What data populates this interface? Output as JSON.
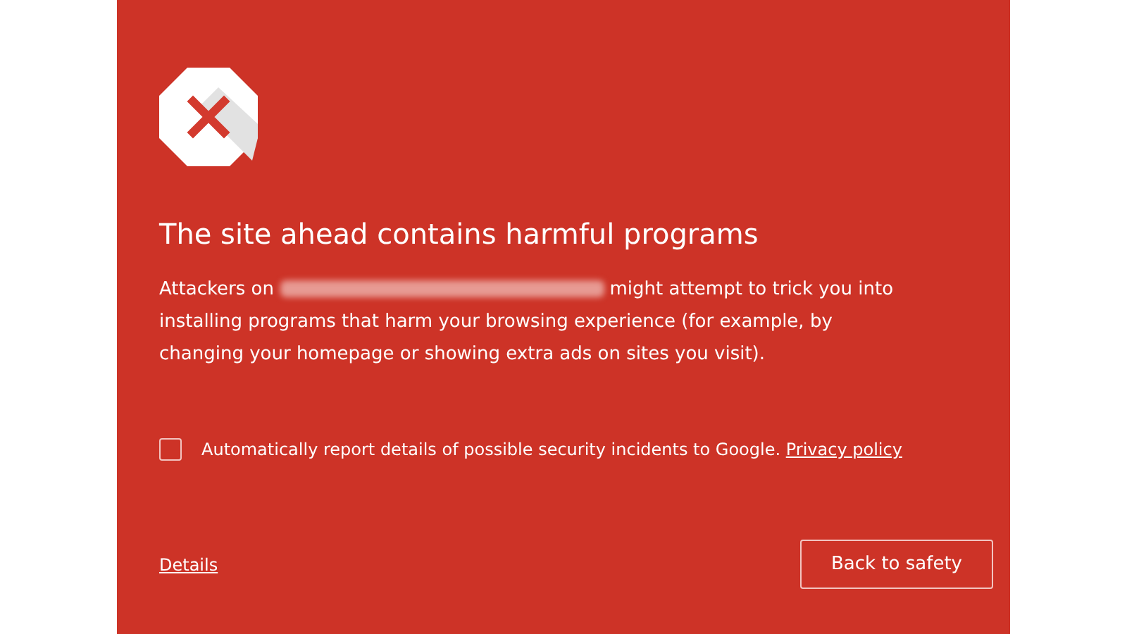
{
  "heading": "The site ahead contains harmful programs",
  "description": {
    "before": "Attackers on",
    "after": "might attempt to trick you into installing programs that harm your browsing experience (for example, by changing your homepage or showing extra ads on sites you visit)."
  },
  "report_option": {
    "label": "Automatically report details of possible security incidents to Google.",
    "link": "Privacy policy",
    "checked": false
  },
  "details_link": "Details",
  "button": "Back to safety"
}
